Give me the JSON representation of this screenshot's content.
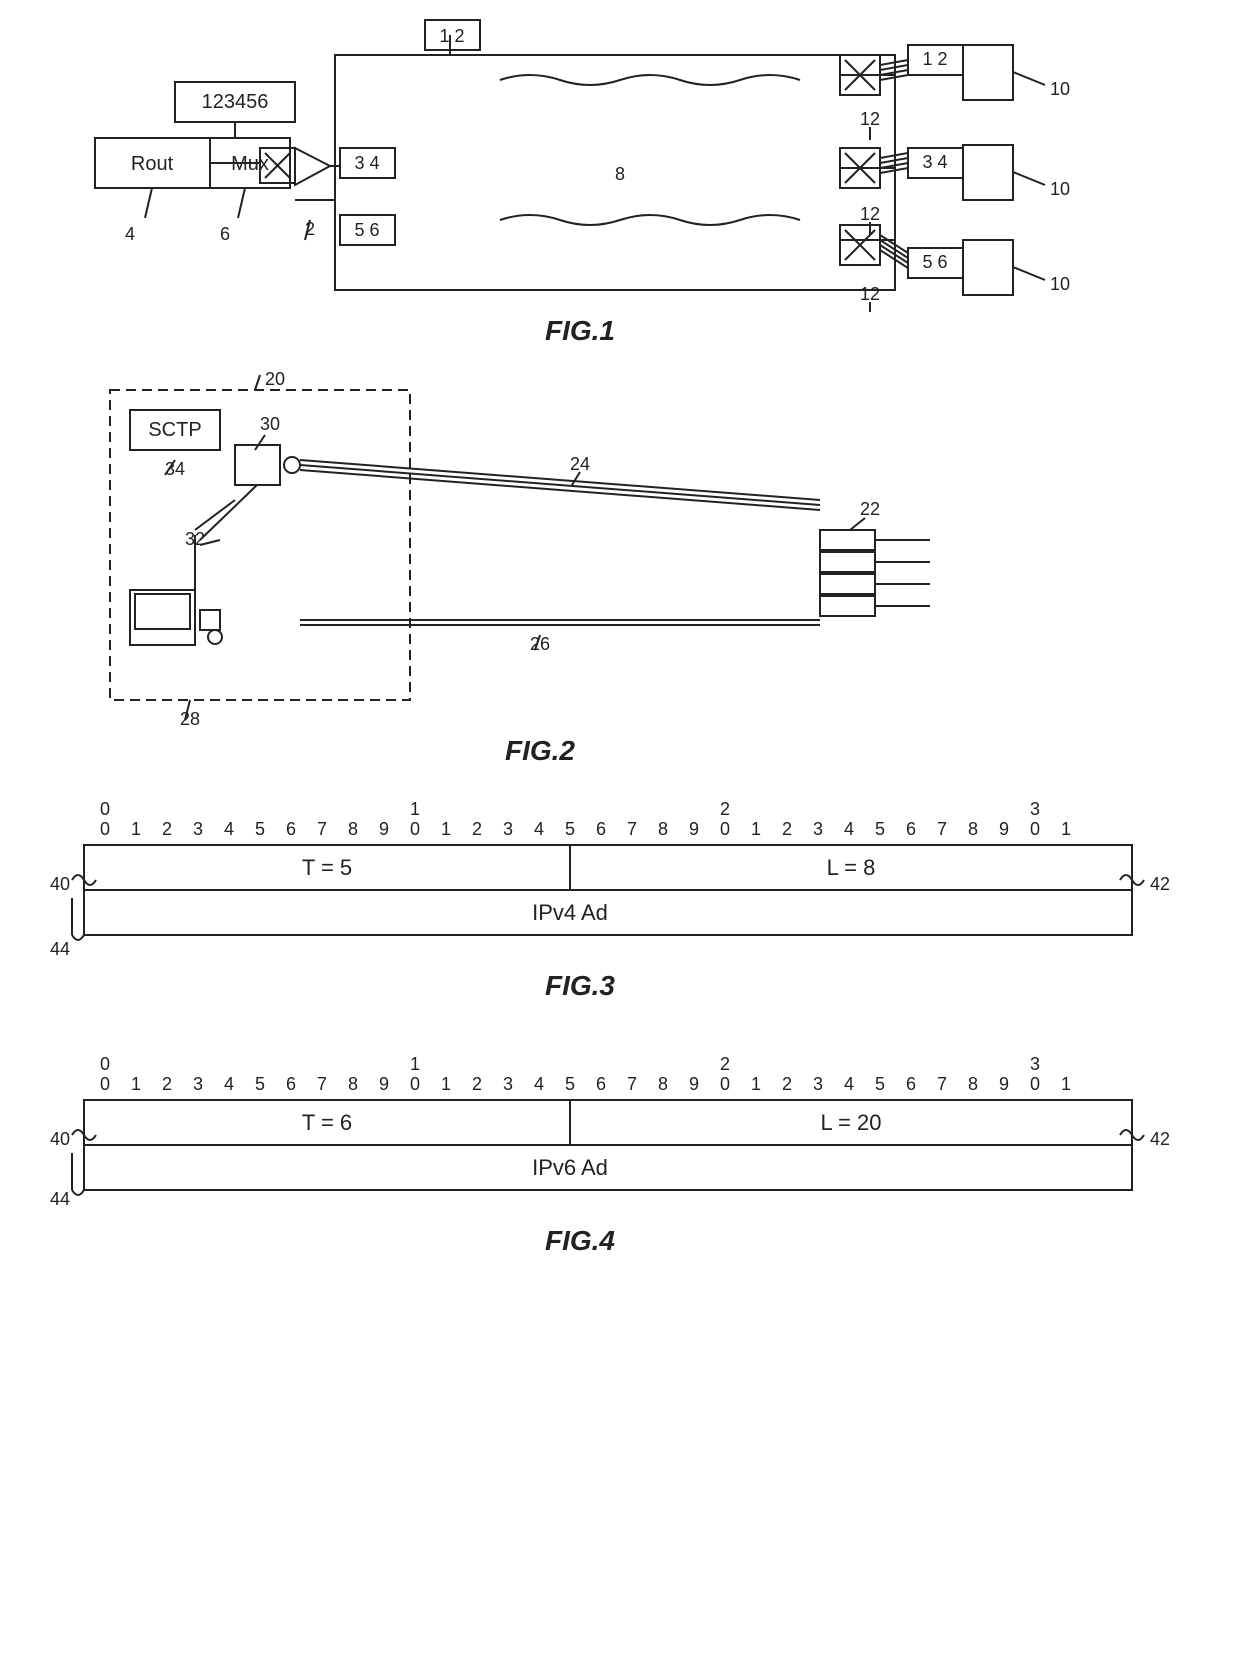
{
  "fig1": {
    "title": "FIG.1",
    "router_label": "Rout",
    "mux_label": "Mux",
    "label_123456": "123456",
    "label_34": "3 4",
    "label_56": "5 6",
    "ref_2": "2",
    "ref_4": "4",
    "ref_6": "6",
    "ref_8": "8",
    "ref_10": "10",
    "ref_12": "12",
    "label_12_top": "1 2",
    "label_34_right": "3 4",
    "label_56_right": "5 6"
  },
  "fig2": {
    "title": "FIG.2",
    "sctp_label": "SCTP",
    "ref_20": "20",
    "ref_22": "22",
    "ref_24": "24",
    "ref_26": "26",
    "ref_28": "28",
    "ref_30": "30",
    "ref_32": "32",
    "ref_34": "34"
  },
  "fig3": {
    "title": "FIG.3",
    "ruler_0": "0",
    "ruler_1": "1",
    "ruler_2": "2",
    "ruler_3": "3",
    "t_value": "T = 5",
    "l_value": "L = 8",
    "ipv4_label": "IPv4  Ad",
    "ref_40": "40",
    "ref_42": "42",
    "ref_44": "44"
  },
  "fig4": {
    "title": "FIG.4",
    "ruler_0": "0",
    "ruler_1": "1",
    "ruler_2": "2",
    "ruler_3": "3",
    "t_value": "T = 6",
    "l_value": "L = 20",
    "ipv6_label": "IPv6  Ad",
    "ref_40": "40",
    "ref_42": "42",
    "ref_44": "44"
  }
}
